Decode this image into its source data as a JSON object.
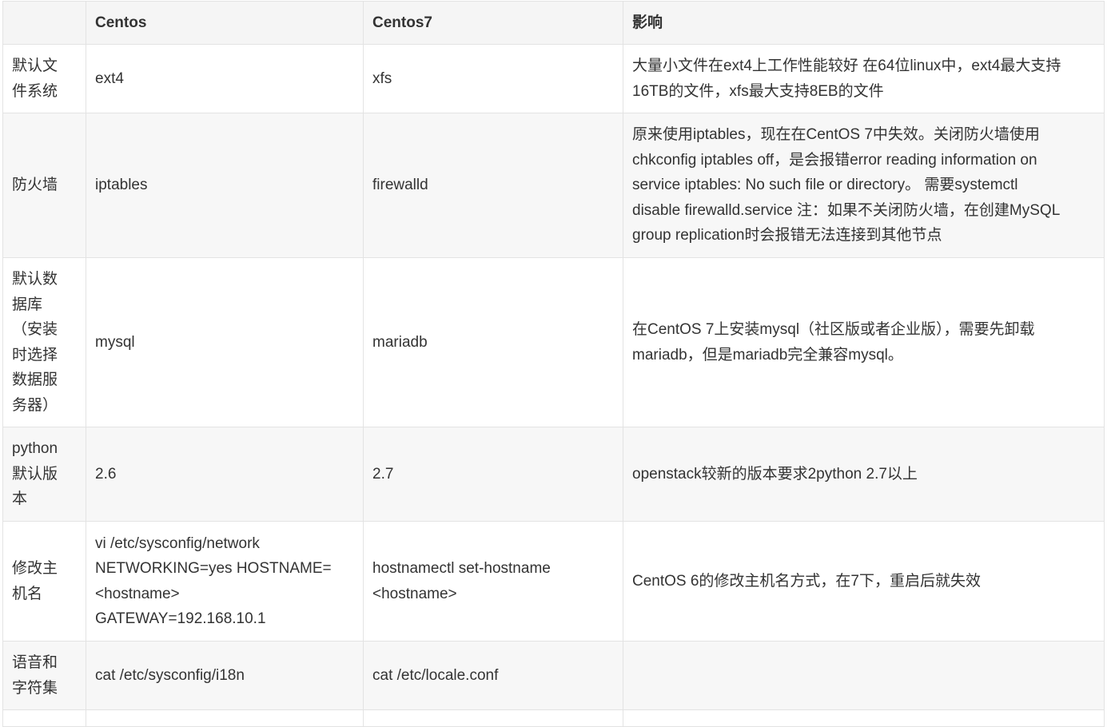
{
  "table": {
    "headers": [
      "",
      "Centos",
      "Centos7",
      "影响"
    ],
    "rows": [
      {
        "c0": [
          "默认文",
          "件系统"
        ],
        "c1": [
          "ext4"
        ],
        "c2": [
          "xfs"
        ],
        "c3": [
          "大量小文件在ext4上工作性能较好 在64位linux中，ext4最大支持",
          "16TB的文件，xfs最大支持8EB的文件"
        ]
      },
      {
        "c0": [
          "防火墙"
        ],
        "c1": [
          "iptables"
        ],
        "c2": [
          "firewalld"
        ],
        "c3": [
          "原来使用iptables，现在在CentOS 7中失效。关闭防火墙使用",
          "chkconfig iptables off，是会报错error reading information on",
          "service iptables: No such file or directory。 需要systemctl",
          "disable firewalld.service 注：如果不关闭防火墙，在创建MySQL",
          "group replication时会报错无法连接到其他节点"
        ]
      },
      {
        "c0": [
          "默认数",
          "据库",
          "（安装",
          "时选择",
          "数据服",
          "务器）"
        ],
        "c1": [
          "mysql"
        ],
        "c2": [
          "mariadb"
        ],
        "c3": [
          "在CentOS 7上安装mysql（社区版或者企业版），需要先卸载",
          "mariadb，但是mariadb完全兼容mysql。"
        ]
      },
      {
        "c0": [
          "python",
          "默认版",
          "本"
        ],
        "c1": [
          "2.6"
        ],
        "c2": [
          "2.7"
        ],
        "c3": [
          "openstack较新的版本要求2python 2.7以上"
        ]
      },
      {
        "c0": [
          "修改主",
          "机名"
        ],
        "c1": [
          "vi /etc/sysconfig/network",
          "NETWORKING=yes HOSTNAME=",
          "<hostname>",
          "GATEWAY=192.168.10.1"
        ],
        "c2": [
          "hostnamectl set-hostname",
          "<hostname>"
        ],
        "c3": [
          "CentOS 6的修改主机名方式，在7下，重启后就失效"
        ]
      },
      {
        "c0": [
          "语音和",
          "字符集"
        ],
        "c1": [
          "cat /etc/sysconfig/i18n"
        ],
        "c2": [
          "cat /etc/locale.conf"
        ],
        "c3": []
      },
      {
        "c0": [],
        "c1": [],
        "c2": [],
        "c3": []
      }
    ]
  }
}
